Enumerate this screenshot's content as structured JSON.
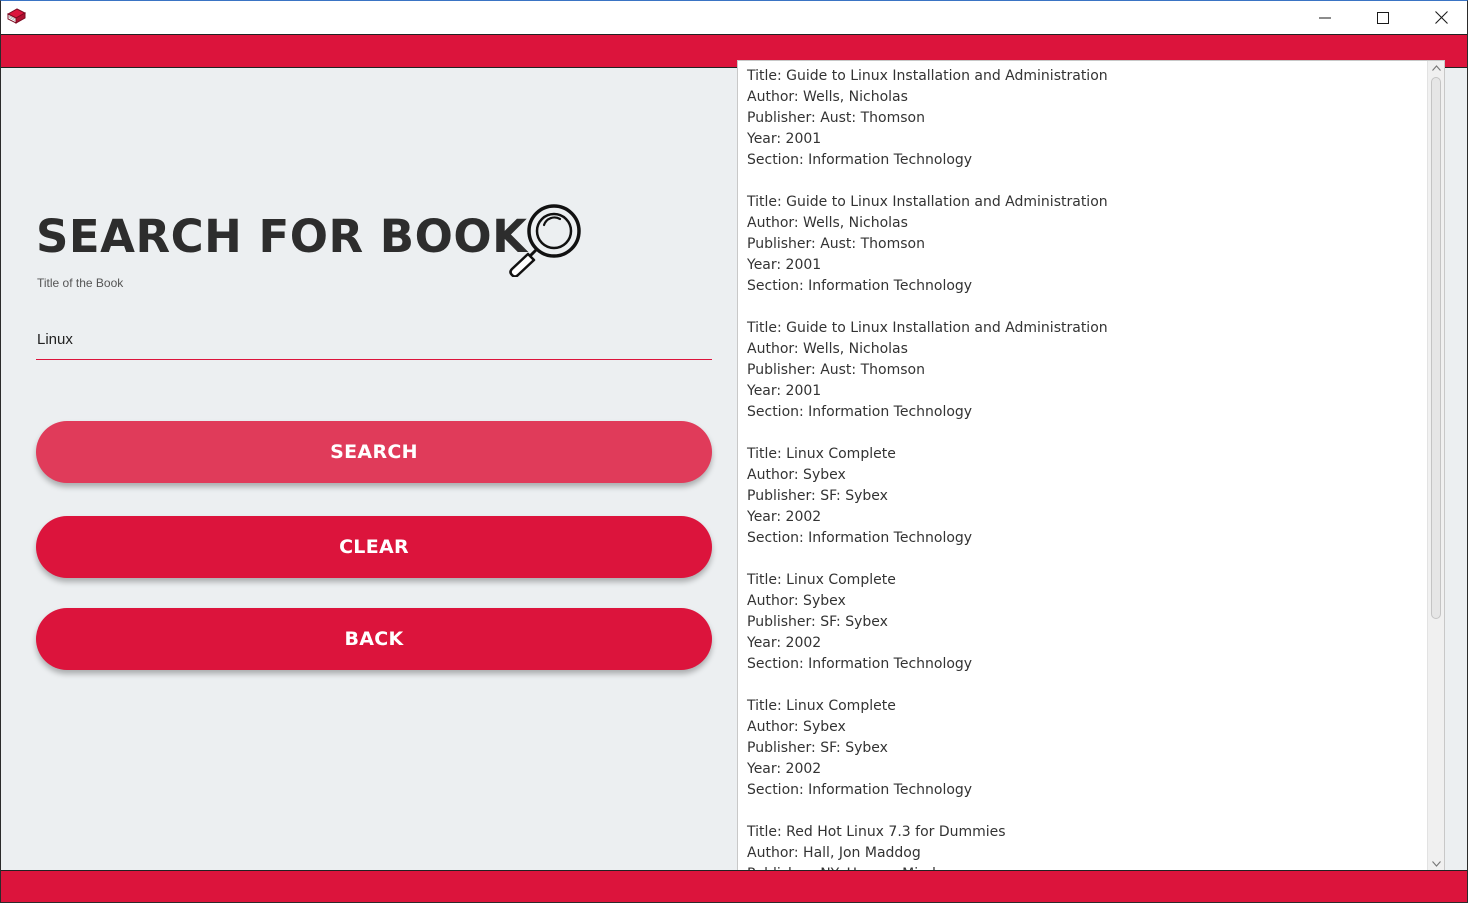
{
  "window": {
    "minimize_icon": "minimize-icon",
    "maximize_icon": "maximize-icon",
    "close_icon": "close-icon",
    "app_icon": "book-icon"
  },
  "colors": {
    "accent": "#dc143c",
    "accent_light": "#e03b5a",
    "background": "#eceff1"
  },
  "form": {
    "heading": "SEARCH FOR BOOK",
    "heading_icon": "magnifier-icon",
    "field_label": "Title of the Book",
    "search_value": "Linux",
    "search_button": "SEARCH",
    "clear_button": "CLEAR",
    "back_button": "BACK"
  },
  "results": {
    "text": "Title: Guide to Linux Installation and Administration\nAuthor: Wells, Nicholas\nPublisher: Aust: Thomson\nYear: 2001\nSection: Information Technology\n\nTitle: Guide to Linux Installation and Administration\nAuthor: Wells, Nicholas\nPublisher: Aust: Thomson\nYear: 2001\nSection: Information Technology\n\nTitle: Guide to Linux Installation and Administration\nAuthor: Wells, Nicholas\nPublisher: Aust: Thomson\nYear: 2001\nSection: Information Technology\n\nTitle: Linux Complete\nAuthor: Sybex\nPublisher: SF: Sybex\nYear: 2002\nSection: Information Technology\n\nTitle: Linux Complete\nAuthor: Sybex\nPublisher: SF: Sybex\nYear: 2002\nSection: Information Technology\n\nTitle: Linux Complete\nAuthor: Sybex\nPublisher: SF: Sybex\nYear: 2002\nSection: Information Technology\n\nTitle: Red Hot Linux 7.3 for Dummies\nAuthor: Hall, Jon Maddog\nPublisher: NY: Hungry Minds"
  }
}
